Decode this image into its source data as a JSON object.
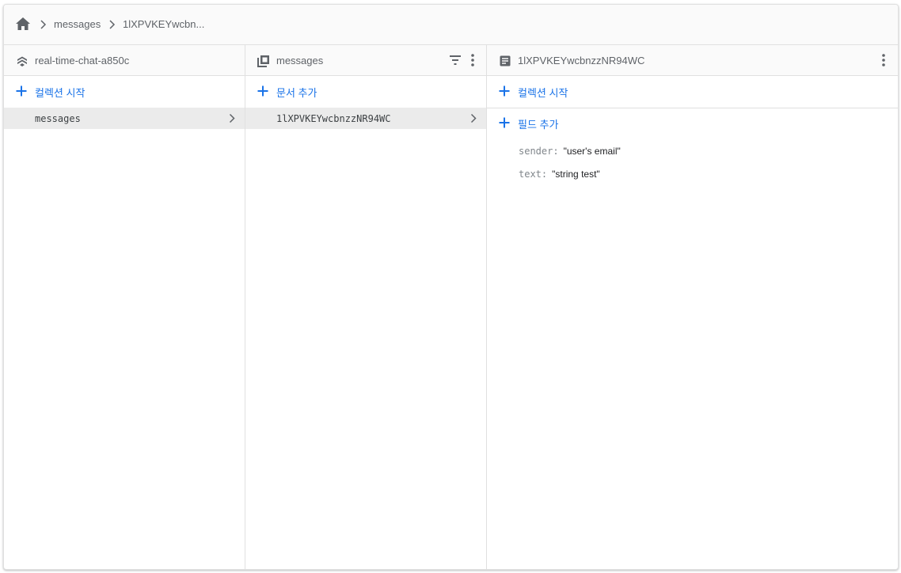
{
  "breadcrumb": {
    "home_icon": "home-icon",
    "items": [
      "messages",
      "1lXPVKEYwcbn..."
    ]
  },
  "colors": {
    "accent": "#1a73e8",
    "selected_row": "#ebebeb",
    "header_bg": "#fafafa",
    "border": "#e0e0e0"
  },
  "panels": {
    "database": {
      "icon": "firestore-icon",
      "title": "real-time-chat-a850c",
      "add_label": "컬렉션 시작",
      "items": [
        "messages"
      ]
    },
    "collection": {
      "icon": "collection-icon",
      "title": "messages",
      "filter_icon": "filter-icon",
      "more_icon": "more-vert-icon",
      "add_label": "문서 추가",
      "items": [
        "1lXPVKEYwcbnzzNR94WC"
      ]
    },
    "document": {
      "icon": "document-icon",
      "title": "1lXPVKEYwcbnzzNR94WC",
      "more_icon": "more-vert-icon",
      "add_collection_label": "컬렉션 시작",
      "add_field_label": "필드 추가",
      "fields": [
        {
          "key": "sender:",
          "value": "\"user's email\""
        },
        {
          "key": "text:",
          "value": "\"string test\""
        }
      ]
    }
  }
}
